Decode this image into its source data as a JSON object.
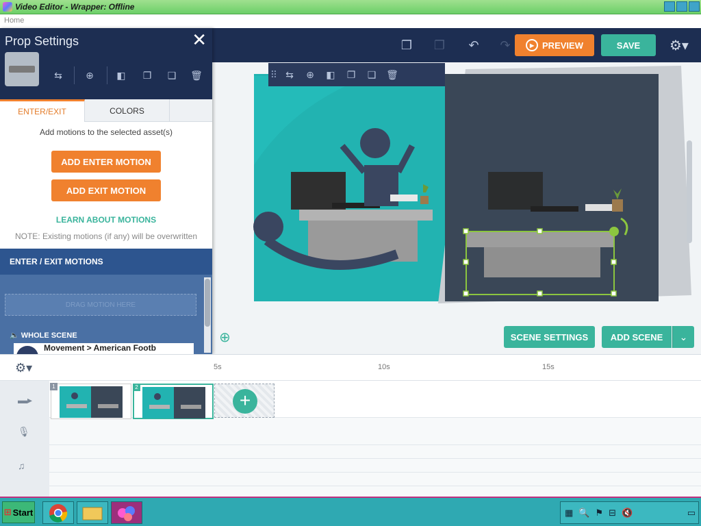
{
  "window": {
    "title": "Video Editor - Wrapper: Offline"
  },
  "menubar": {
    "home": "Home"
  },
  "header": {
    "preview_label": "PREVIEW",
    "save_label": "SAVE"
  },
  "panel": {
    "title": "Prop Settings",
    "tabs": [
      {
        "label": "ENTER/EXIT"
      },
      {
        "label": "COLORS"
      }
    ],
    "hint": "Add motions to the selected asset(s)",
    "add_enter_label": "ADD ENTER MOTION",
    "add_exit_label": "ADD EXIT MOTION",
    "learn_label": "LEARN ABOUT MOTIONS",
    "note": "NOTE: Existing motions (if any) will be overwritten",
    "motions_header": "ENTER / EXIT MOTIONS",
    "dropzone": "DRAG MOTION HERE",
    "whole_scene": "WHOLE SCENE",
    "motion_item": "Movement > American Footb"
  },
  "stage": {
    "scene_settings_label": "SCENE SETTINGS",
    "add_scene_label": "ADD SCENE"
  },
  "timeline": {
    "ticks": [
      "5s",
      "10s",
      "15s"
    ],
    "scenes": [
      {
        "num": "1"
      },
      {
        "num": "2"
      }
    ]
  },
  "taskbar": {
    "start_label": "Start"
  },
  "colors": {
    "accent_orange": "#f0812e",
    "accent_teal": "#3ab49c",
    "header_navy": "#1d2e52"
  }
}
